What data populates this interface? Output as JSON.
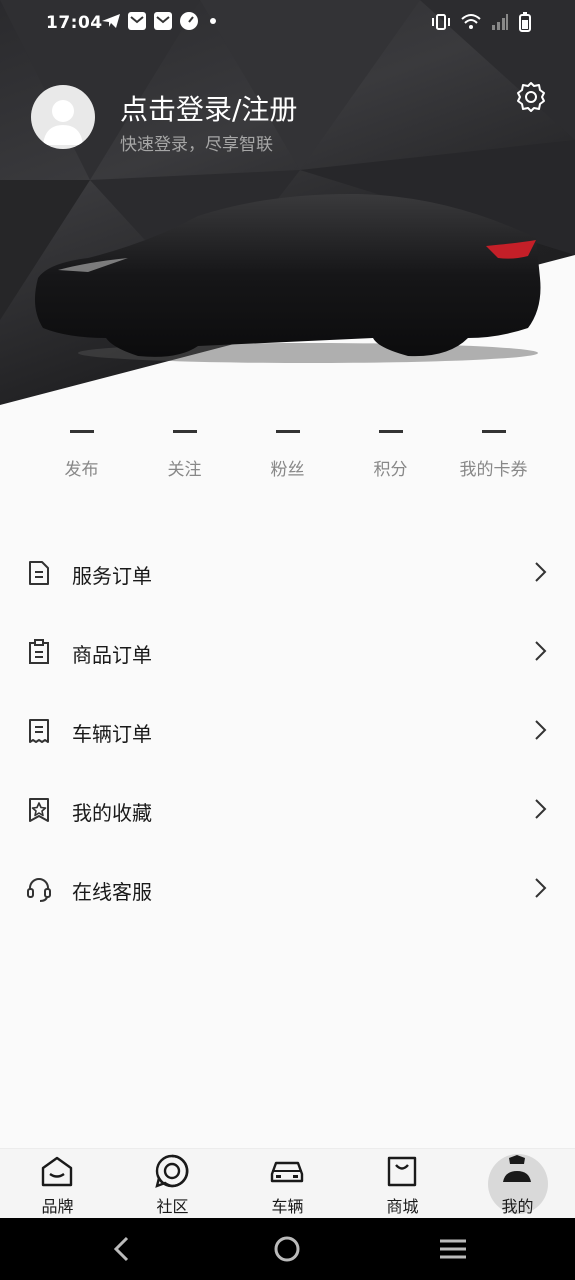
{
  "status_bar": {
    "time": "17:04",
    "left_icons": [
      "telegram-icon",
      "mail-icon",
      "mail-icon",
      "speedometer-icon",
      "dot-icon"
    ],
    "right_icons": [
      "vibrate-icon",
      "wifi-icon",
      "signal-icon",
      "battery-icon"
    ]
  },
  "profile": {
    "login_title": "点击登录/注册",
    "login_subtitle": "快速登录，尽享智联"
  },
  "stats": [
    {
      "value": "—",
      "label": "发布"
    },
    {
      "value": "—",
      "label": "关注"
    },
    {
      "value": "—",
      "label": "粉丝"
    },
    {
      "value": "—",
      "label": "积分"
    },
    {
      "value": "—",
      "label": "我的卡券"
    }
  ],
  "menu": [
    {
      "label": "服务订单",
      "icon": "document-icon"
    },
    {
      "label": "商品订单",
      "icon": "clipboard-icon"
    },
    {
      "label": "车辆订单",
      "icon": "receipt-icon"
    },
    {
      "label": "我的收藏",
      "icon": "star-bookmark-icon"
    },
    {
      "label": "在线客服",
      "icon": "headset-icon"
    }
  ],
  "tabbar": [
    {
      "label": "品牌",
      "icon": "home-icon"
    },
    {
      "label": "社区",
      "icon": "community-icon"
    },
    {
      "label": "车辆",
      "icon": "car-icon"
    },
    {
      "label": "商城",
      "icon": "shopping-bag-icon"
    },
    {
      "label": "我的",
      "icon": "profile-icon",
      "active": true
    }
  ],
  "colors": {
    "hero_bg": "#2a2a2d",
    "page_bg": "#fafafa",
    "accent_red": "#d0202a",
    "tabbar_bg": "#f5f5f5"
  }
}
